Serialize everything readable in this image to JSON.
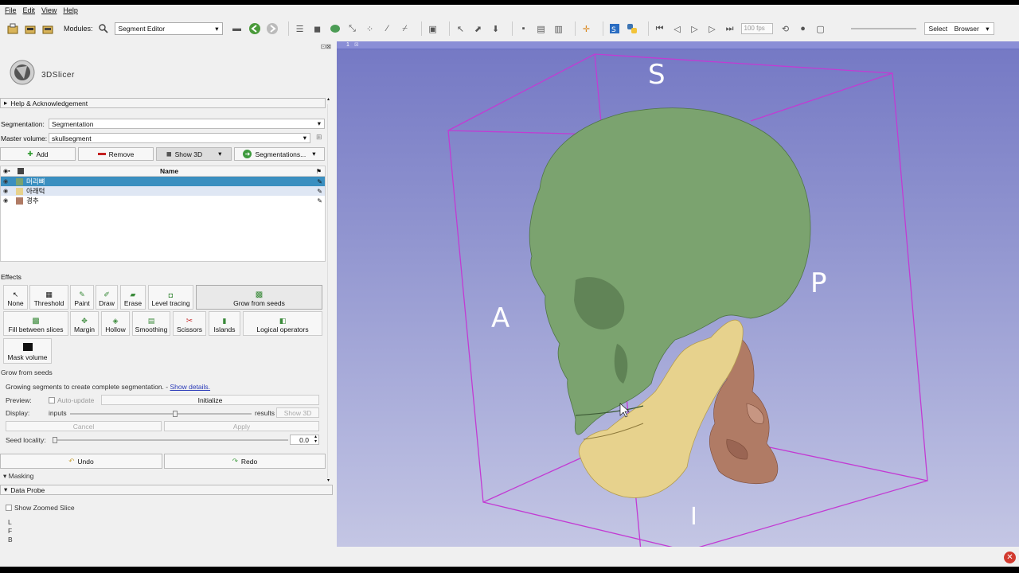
{
  "menu": [
    "File",
    "Edit",
    "View",
    "Help"
  ],
  "toolbar": {
    "modules_label": "Modules:",
    "module_selected": "Segment Editor",
    "fps_value": "100 fps",
    "select_label": "Select",
    "browser_label": "Browser"
  },
  "app": {
    "logo_text": "3DSlicer"
  },
  "help_section": "Help & Acknowledgement",
  "segmentation": {
    "label": "Segmentation:",
    "value": "Segmentation"
  },
  "master_volume": {
    "label": "Master volume:",
    "value": "skullsegment"
  },
  "buttons": {
    "add": "Add",
    "remove": "Remove",
    "show3d": "Show 3D",
    "segmentations": "Segmentations..."
  },
  "table": {
    "header": "Name",
    "rows": [
      {
        "name": "머리뼈",
        "color": "#7ba36f"
      },
      {
        "name": "아래턱",
        "color": "#e7d28d"
      },
      {
        "name": "경추",
        "color": "#b07b65"
      }
    ]
  },
  "effects": {
    "label": "Effects",
    "items": [
      "None",
      "Threshold",
      "Paint",
      "Draw",
      "Erase",
      "Level tracing",
      "Grow from seeds",
      "Fill between slices",
      "Margin",
      "Hollow",
      "Smoothing",
      "Scissors",
      "Islands",
      "Logical operators",
      "Mask volume"
    ]
  },
  "grow": {
    "section": "Grow from seeds",
    "description": "Growing segments to create complete segmentation. -",
    "show_details": "Show details.",
    "preview_label": "Preview:",
    "auto_update": "Auto-update",
    "initialize": "Initialize",
    "display_label": "Display:",
    "inputs": "inputs",
    "results": "results",
    "show3d": "Show 3D",
    "cancel": "Cancel",
    "apply": "Apply",
    "seed_locality_label": "Seed locality:",
    "seed_locality_value": "0.0",
    "display_level": 0.58
  },
  "undo": "Undo",
  "redo": "Redo",
  "masking": "Masking",
  "data_probe": "Data Probe",
  "show_zoomed_slice": "Show Zoomed Slice",
  "probe_letters": [
    "L",
    "F",
    "B"
  ],
  "view": {
    "pin": "1",
    "labels": {
      "S": "S",
      "P": "P",
      "A": "A",
      "I": "I"
    },
    "colors": {
      "skull": "#7ba36f",
      "jaw": "#e7d28d",
      "spine": "#b07b65",
      "box": "#c23bd3"
    }
  }
}
